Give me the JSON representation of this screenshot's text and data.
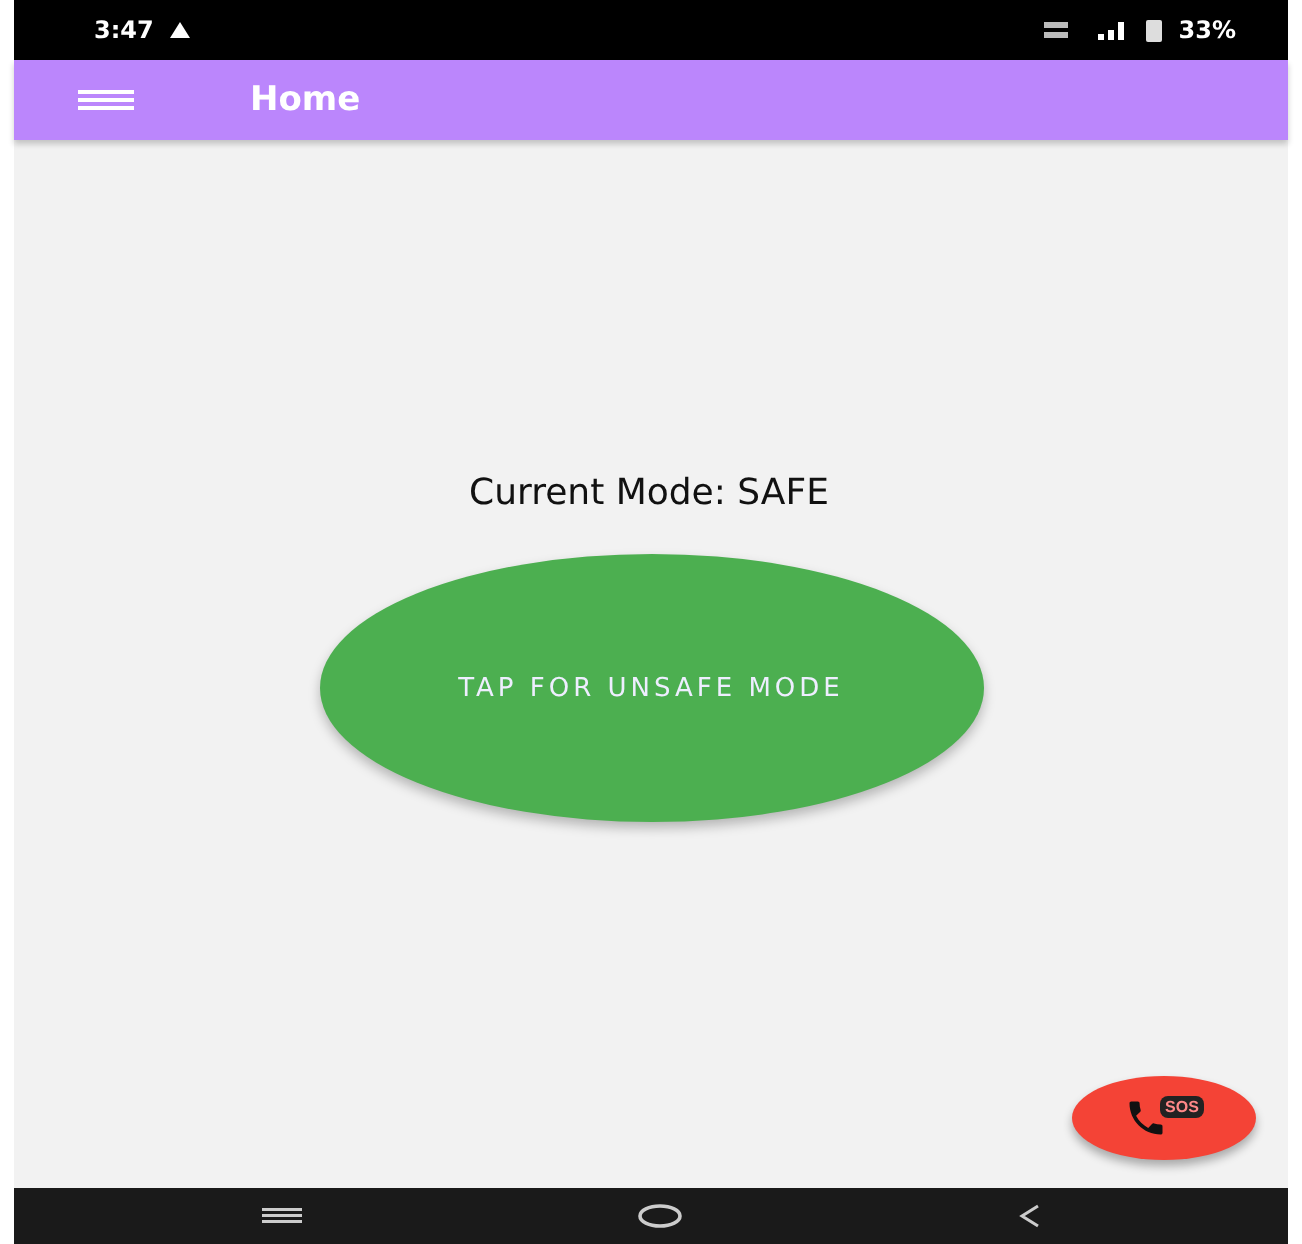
{
  "status_bar": {
    "time": "3:47",
    "battery": "33%"
  },
  "app_bar": {
    "title": "Home"
  },
  "mode": {
    "label": "Current Mode: SAFE",
    "button": "TAP FOR UNSAFE MODE"
  },
  "sos_button": {
    "label": "SOS"
  }
}
